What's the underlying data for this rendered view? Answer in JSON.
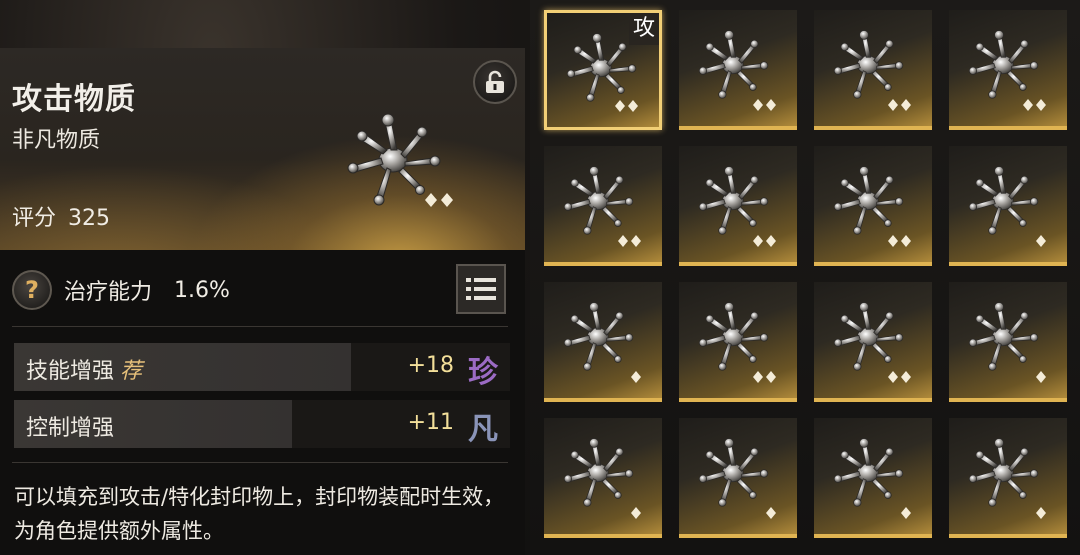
{
  "item": {
    "title": "攻击物质",
    "subtitle": "非凡物质",
    "score_label": "评分",
    "score_value": "325",
    "icon": "splat-material-icon",
    "rarity_diamonds": 2
  },
  "main_stat": {
    "icon": "question-mark-icon",
    "label": "治疗能力",
    "value": "1.6%"
  },
  "sub_stats": [
    {
      "label": "技能增强",
      "tag": "荐",
      "value": "+18",
      "grade": "珍",
      "grade_color": "#9b6bc4",
      "fill": 0.68
    },
    {
      "label": "控制增强",
      "tag": "",
      "value": "+11",
      "grade": "凡",
      "grade_color": "#8a94b8",
      "fill": 0.56
    }
  ],
  "description": "可以填充到攻击/特化封印物上，封印物装配时生效，为角色提供额外属性。",
  "grid": {
    "selected_tag": "攻",
    "slots": [
      {
        "diamonds": 2,
        "selected": true
      },
      {
        "diamonds": 2,
        "selected": false
      },
      {
        "diamonds": 2,
        "selected": false
      },
      {
        "diamonds": 2,
        "selected": false
      },
      {
        "diamonds": 2,
        "selected": false
      },
      {
        "diamonds": 2,
        "selected": false
      },
      {
        "diamonds": 2,
        "selected": false
      },
      {
        "diamonds": 1,
        "selected": false
      },
      {
        "diamonds": 1,
        "selected": false
      },
      {
        "diamonds": 2,
        "selected": false
      },
      {
        "diamonds": 2,
        "selected": false
      },
      {
        "diamonds": 1,
        "selected": false
      },
      {
        "diamonds": 1,
        "selected": false
      },
      {
        "diamonds": 1,
        "selected": false
      },
      {
        "diamonds": 1,
        "selected": false
      },
      {
        "diamonds": 1,
        "selected": false
      }
    ]
  },
  "colors": {
    "gold_accent": "#e0b452",
    "value_yellow": "#f3df9a"
  }
}
